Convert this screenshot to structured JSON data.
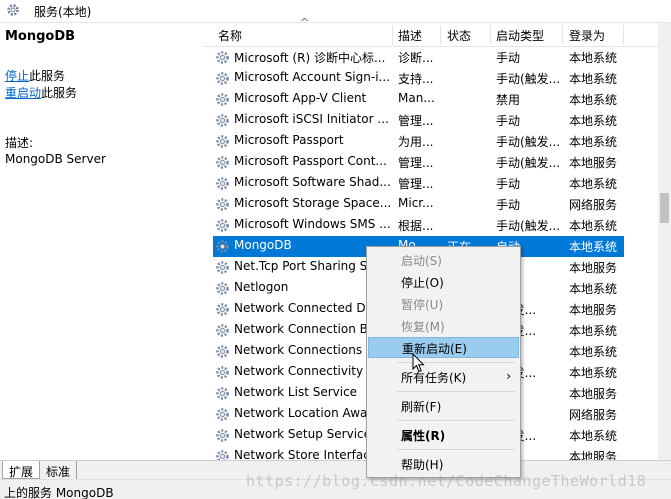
{
  "window": {
    "title": "服务(本地)"
  },
  "details": {
    "service_name": "MongoDB",
    "stop_link": "停止",
    "stop_suffix": "此服务",
    "restart_link": "重启动",
    "restart_suffix": "此服务",
    "description_label": "描述:",
    "description_text": "MongoDB Server"
  },
  "columns": [
    "名称",
    "描述",
    "状态",
    "启动类型",
    "登录为"
  ],
  "services": [
    {
      "name": "Microsoft (R) 诊断中心标...",
      "desc": "诊断...",
      "status": "",
      "startup": "手动",
      "logon": "本地系统"
    },
    {
      "name": "Microsoft Account Sign-i...",
      "desc": "支持...",
      "status": "",
      "startup": "手动(触发...",
      "logon": "本地系统"
    },
    {
      "name": "Microsoft App-V Client",
      "desc": "Man...",
      "status": "",
      "startup": "禁用",
      "logon": "本地系统"
    },
    {
      "name": "Microsoft iSCSI Initiator ...",
      "desc": "管理...",
      "status": "",
      "startup": "手动",
      "logon": "本地系统"
    },
    {
      "name": "Microsoft Passport",
      "desc": "为用...",
      "status": "",
      "startup": "手动(触发...",
      "logon": "本地系统"
    },
    {
      "name": "Microsoft Passport Cont...",
      "desc": "管理...",
      "status": "",
      "startup": "手动(触发...",
      "logon": "本地服务"
    },
    {
      "name": "Microsoft Software Shad...",
      "desc": "管理...",
      "status": "",
      "startup": "手动",
      "logon": "本地系统"
    },
    {
      "name": "Microsoft Storage Space...",
      "desc": "Micr...",
      "status": "",
      "startup": "手动",
      "logon": "网络服务"
    },
    {
      "name": "Microsoft Windows SMS ...",
      "desc": "根据...",
      "status": "",
      "startup": "手动(触发...",
      "logon": "本地系统"
    },
    {
      "name": "MongoDB",
      "desc": "Mo...",
      "status": "正在...",
      "startup": "自动",
      "logon": "本地系统",
      "selected": true
    },
    {
      "name": "Net.Tcp Port Sharing S",
      "desc": "",
      "status": "",
      "startup": "",
      "logon": "本地服务"
    },
    {
      "name": "Netlogon",
      "desc": "",
      "status": "",
      "startup": "",
      "logon": "本地系统"
    },
    {
      "name": "Network Connected De",
      "desc": "",
      "status": "",
      "startup": "(触发...",
      "logon": "本地服务"
    },
    {
      "name": "Network Connection B",
      "desc": "",
      "status": "",
      "startup": "(触发...",
      "logon": "本地系统"
    },
    {
      "name": "Network Connections",
      "desc": "",
      "status": "",
      "startup": "",
      "logon": "本地系统"
    },
    {
      "name": "Network Connectivity A",
      "desc": "",
      "status": "",
      "startup": "(触发...",
      "logon": "本地系统"
    },
    {
      "name": "Network List Service",
      "desc": "",
      "status": "",
      "startup": "",
      "logon": "本地服务"
    },
    {
      "name": "Network Location Awa",
      "desc": "",
      "status": "",
      "startup": "",
      "logon": "网络服务"
    },
    {
      "name": "Network Setup Service",
      "desc": "",
      "status": "",
      "startup": "(触发...",
      "logon": "本地系统"
    },
    {
      "name": "Network Store Interfac",
      "desc": "",
      "status": "",
      "startup": "",
      "logon": "本地服务"
    }
  ],
  "context_menu": {
    "start": "启动(S)",
    "stop": "停止(O)",
    "pause": "暂停(U)",
    "resume": "恢复(M)",
    "restart": "重新启动(E)",
    "all_tasks": "所有任务(K)",
    "refresh": "刷新(F)",
    "properties": "属性(R)",
    "help": "帮助(H)"
  },
  "tabs": [
    "扩展",
    "标准"
  ],
  "statusbar": "上的服务 MongoDB",
  "watermark": "https://blog.csdn.net/CodeChangeTheWorld18",
  "colors": {
    "selection": "#0078d7",
    "menu_highlight": "#99ccee",
    "link": "#0066cc"
  },
  "icons": {
    "service": "gear-icon"
  }
}
